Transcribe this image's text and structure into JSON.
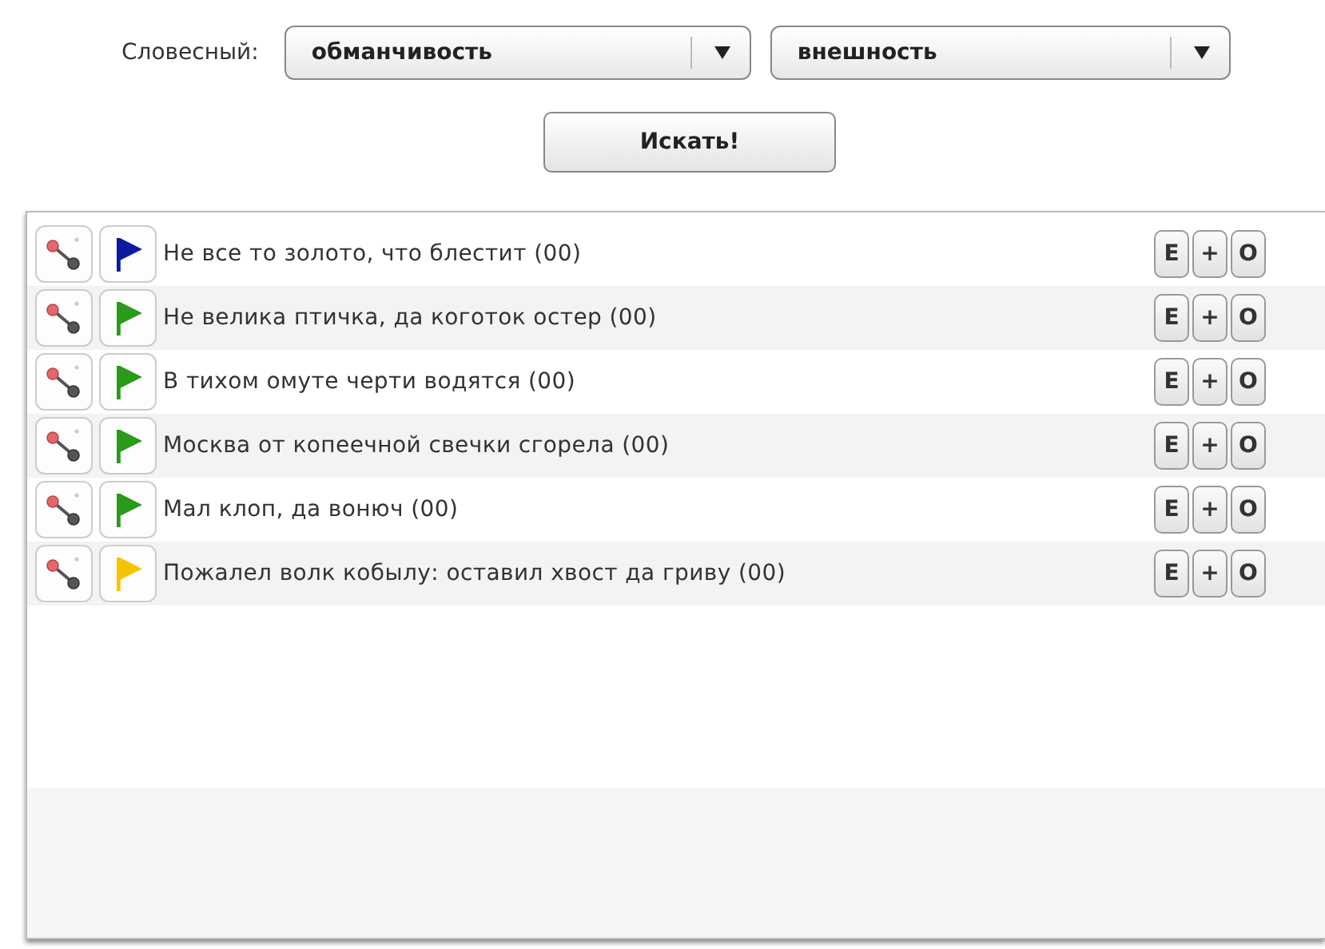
{
  "filter": {
    "label": "Словесный:",
    "selects": [
      {
        "value": "обманчивость"
      },
      {
        "value": "внешность"
      }
    ],
    "search_button": "Искать!"
  },
  "results": [
    {
      "text": "Не все то золото, что блестит (00)",
      "color": "#0b1a9e",
      "actions": [
        "E",
        "+",
        "O"
      ]
    },
    {
      "text": "Не велика птичка, да коготок остер (00)",
      "color": "#2a9a1a",
      "actions": [
        "E",
        "+",
        "O"
      ]
    },
    {
      "text": "В тихом омуте черти водятся (00)",
      "color": "#2a9a1a",
      "actions": [
        "E",
        "+",
        "O"
      ]
    },
    {
      "text": "Москва от копеечной свечки сгорела (00)",
      "color": "#2a9a1a",
      "actions": [
        "E",
        "+",
        "O"
      ]
    },
    {
      "text": "Мал клоп, да вонюч (00)",
      "color": "#2a9a1a",
      "actions": [
        "E",
        "+",
        "O"
      ]
    },
    {
      "text": "Пожалел волк кобылу: оставил хвост да гриву (00)",
      "color": "#f5c400",
      "actions": [
        "E",
        "+",
        "O"
      ]
    }
  ]
}
